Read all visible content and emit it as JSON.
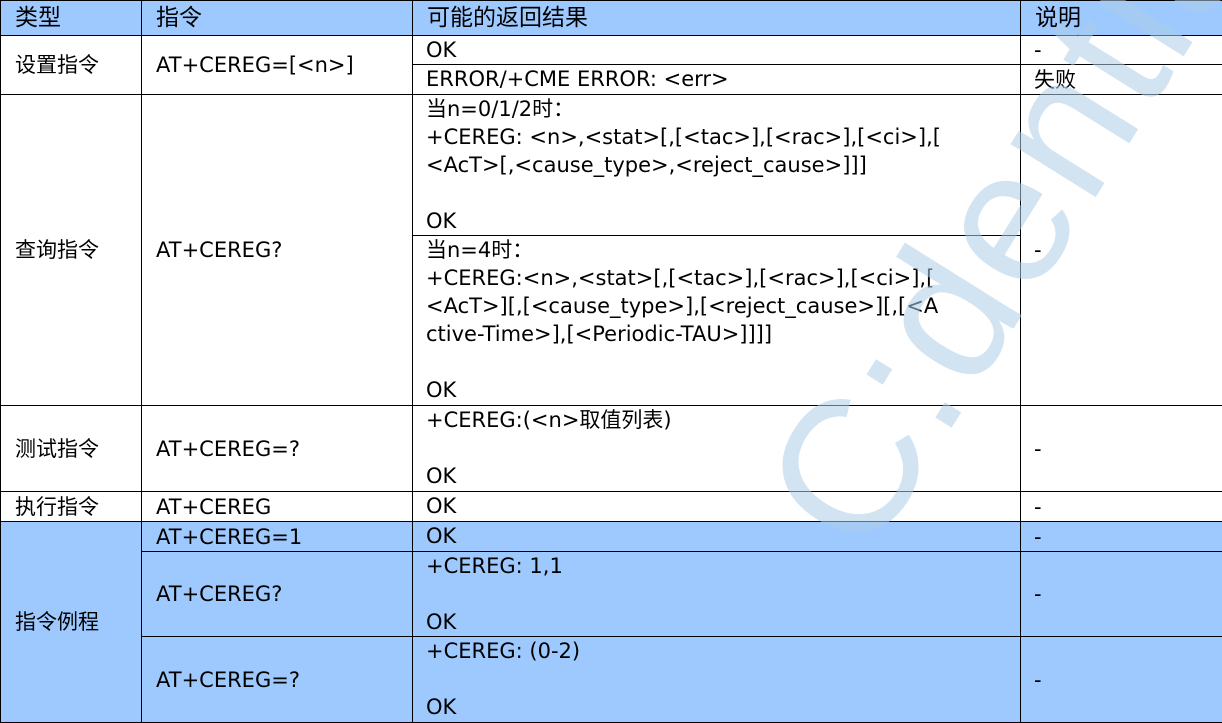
{
  "header": {
    "type": "类型",
    "command": "指令",
    "results": "可能的返回结果",
    "note": "说明"
  },
  "rows": {
    "set": {
      "type": "设置指令",
      "command": "AT+CEREG=[<n>]",
      "result_ok": "OK",
      "note_ok": "-",
      "result_err": "ERROR/+CME ERROR: <err>",
      "note_err": "失败"
    },
    "query": {
      "type": "查询指令",
      "command": "AT+CEREG?",
      "block1": {
        "l1": "当n=0/1/2时：",
        "l2": "+CEREG:  <n>,<stat>[,[<tac>],[<rac>],[<ci>],[",
        "l3": "<AcT>[,<cause_type>,<reject_cause>]]]",
        "ok": "OK"
      },
      "block2": {
        "l1": "当n=4时：",
        "l2": "+CEREG:<n>,<stat>[,[<tac>],[<rac>],[<ci>],[",
        "l3": "<AcT>][,[<cause_type>],[<reject_cause>][,[<A",
        "l4": "ctive-Time>],[<Periodic-TAU>]]]]",
        "ok": "OK"
      },
      "note": "-"
    },
    "test": {
      "type": "测试指令",
      "command": "AT+CEREG=?",
      "l1": "+CEREG:(<n>取值列表)",
      "ok": "OK",
      "note": "-"
    },
    "exec": {
      "type": "执行指令",
      "command": "AT+CEREG",
      "result": "OK",
      "note": "-"
    }
  },
  "example": {
    "type": "指令例程",
    "rows": [
      {
        "command": "AT+CEREG=1",
        "l1": "OK",
        "ok": "",
        "note": "-"
      },
      {
        "command": "AT+CEREG?",
        "l1": "+CEREG: 1,1",
        "ok": "OK",
        "note": "-"
      },
      {
        "command": "AT+CEREG=?",
        "l1": "+CEREG: (0-2)",
        "ok": "OK",
        "note": "-"
      }
    ]
  },
  "watermark": "C:dential"
}
